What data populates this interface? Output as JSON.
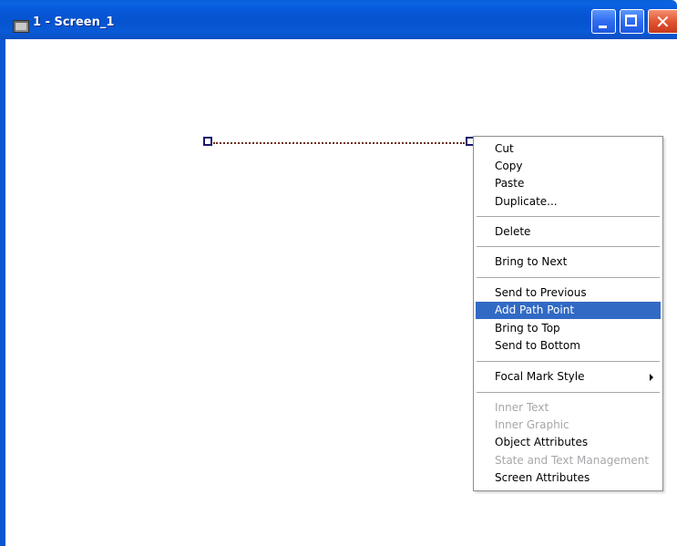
{
  "window": {
    "title": "1 - Screen_1",
    "icon": "screen-app-icon",
    "controls": {
      "minimize": "minimize-icon",
      "maximize": "maximize-icon",
      "close": "close-icon",
      "close_glyph": "✕"
    }
  },
  "colors": {
    "titlebar": "#0553cf",
    "menu_highlight": "#316ac5",
    "disabled_text": "#a7a6aa",
    "handle": "#1a1a6e",
    "path_line": "#6b2d1c"
  },
  "context_menu": {
    "items": [
      {
        "label": "Cut",
        "enabled": true
      },
      {
        "label": "Copy",
        "enabled": true
      },
      {
        "label": "Paste",
        "enabled": true
      },
      {
        "label": "Duplicate...",
        "enabled": true
      },
      {
        "label": "Delete",
        "enabled": true
      },
      {
        "label": "Bring to Next",
        "enabled": true
      },
      {
        "label": "Send to Previous",
        "enabled": true
      },
      {
        "label": "Add Path Point",
        "enabled": true,
        "highlighted": true
      },
      {
        "label": "Bring to Top",
        "enabled": true
      },
      {
        "label": "Send to Bottom",
        "enabled": true
      },
      {
        "label": "Focal Mark Style",
        "enabled": true,
        "submenu": true
      },
      {
        "label": "Inner Text",
        "enabled": false
      },
      {
        "label": "Inner Graphic",
        "enabled": false
      },
      {
        "label": "Object Attributes",
        "enabled": true
      },
      {
        "label": "State and Text Management",
        "enabled": false
      },
      {
        "label": "Screen Attributes",
        "enabled": true
      }
    ]
  }
}
